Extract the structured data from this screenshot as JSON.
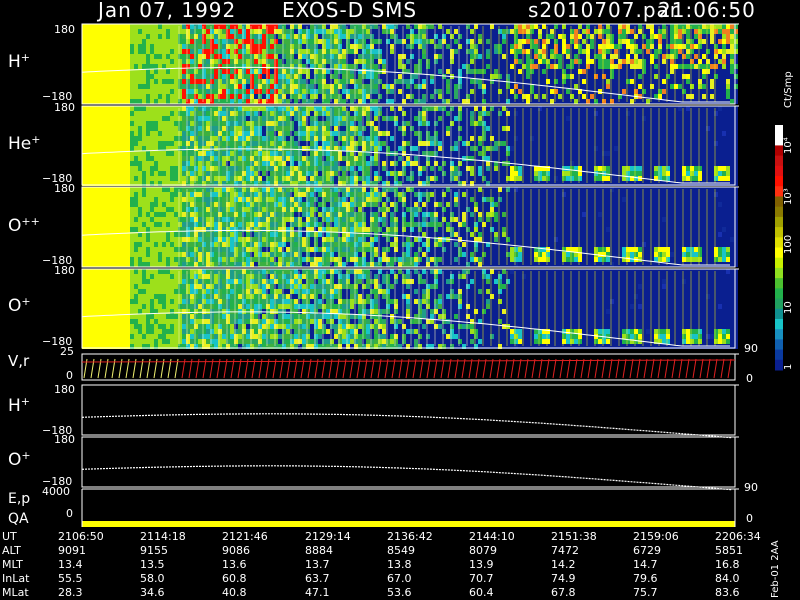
{
  "header": {
    "date": "Jan 07, 1992",
    "instrument": "EXOS-D SMS",
    "file": "s2010707.par",
    "time": "21:06:50"
  },
  "panels": [
    {
      "label": "H",
      "charge": "+",
      "ymax": "180",
      "ymin": "−180"
    },
    {
      "label": "He",
      "charge": "+",
      "ymax": "180",
      "ymin": "−180"
    },
    {
      "label": "O",
      "charge": "++",
      "ymax": "180",
      "ymin": "−180"
    },
    {
      "label": "O",
      "charge": "+",
      "ymax": "180",
      "ymin": "−180"
    }
  ],
  "vr_panel": {
    "label": "V,r",
    "ymax": "25",
    "ymin": "0",
    "right_top": "90",
    "right_bottom": "0"
  },
  "h_panel": {
    "label": "H",
    "charge": "+",
    "ymax": "180",
    "ymin": "−180"
  },
  "o_panel": {
    "label": "O",
    "charge": "+",
    "ymax": "180",
    "ymin": "−180"
  },
  "ep_panel": {
    "label": "E,p",
    "ymax": "4000",
    "right_top": "90"
  },
  "qa_panel": {
    "label": "QA",
    "ymin": "0",
    "right_bottom": "0"
  },
  "colorbar": {
    "unit": "Ct/Smp",
    "labels": [
      "10⁴",
      "10³",
      "100",
      "10",
      "1"
    ]
  },
  "footer": {
    "rows": [
      {
        "name": "UT",
        "values": [
          "2106:50",
          "2114:18",
          "2121:46",
          "2129:14",
          "2136:42",
          "2144:10",
          "2151:38",
          "2159:06",
          "2206:34"
        ]
      },
      {
        "name": "ALT",
        "values": [
          "9091",
          "9155",
          "9086",
          "8884",
          "8549",
          "8079",
          "7472",
          "6729",
          "5851"
        ]
      },
      {
        "name": "MLT",
        "values": [
          "13.4",
          "13.5",
          "13.6",
          "13.7",
          "13.8",
          "13.9",
          "14.2",
          "14.7",
          "16.8"
        ]
      },
      {
        "name": "InLat",
        "values": [
          "55.5",
          "58.0",
          "60.8",
          "63.7",
          "67.0",
          "70.7",
          "74.9",
          "79.6",
          "84.0"
        ]
      },
      {
        "name": "MLat",
        "values": [
          "28.3",
          "34.6",
          "40.8",
          "47.1",
          "53.6",
          "60.4",
          "67.8",
          "75.7",
          "83.6"
        ]
      }
    ],
    "stamp": "Feb-01 2AA"
  },
  "chart_data": {
    "type": "heatmap",
    "x_ticks": [
      "2106:50",
      "2114:18",
      "2121:46",
      "2129:14",
      "2136:42",
      "2144:10",
      "2151:38",
      "2159:06",
      "2206:34"
    ],
    "ylim": [
      -180,
      180
    ],
    "color_scale": "log",
    "color_range": [
      1,
      10000
    ],
    "colors": {
      "yellow": "#ffff00",
      "green": "#22b14c",
      "lime": "#9de01b",
      "blue": "#0a1f90",
      "red": "#ff1000",
      "cyan": "#18c4c8"
    }
  }
}
